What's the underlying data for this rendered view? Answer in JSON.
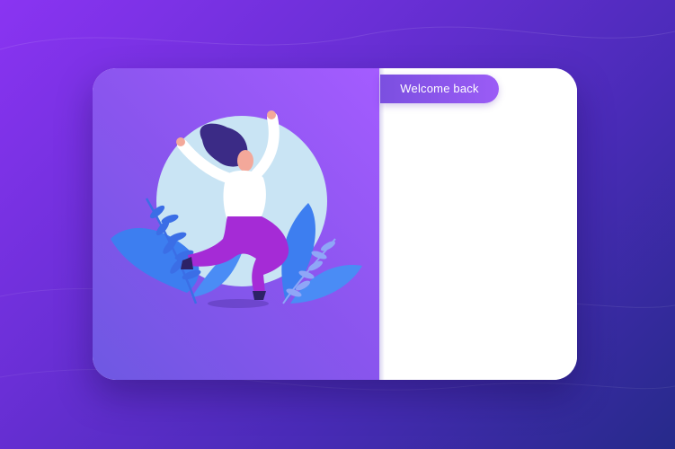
{
  "welcome": {
    "label": "Welcome back"
  },
  "illustration": {
    "icon": "jumping-woman-illustration-icon"
  },
  "colors": {
    "accent": "#8a55ee",
    "tab": "#8b56eb",
    "card_right": "#ffffff"
  }
}
